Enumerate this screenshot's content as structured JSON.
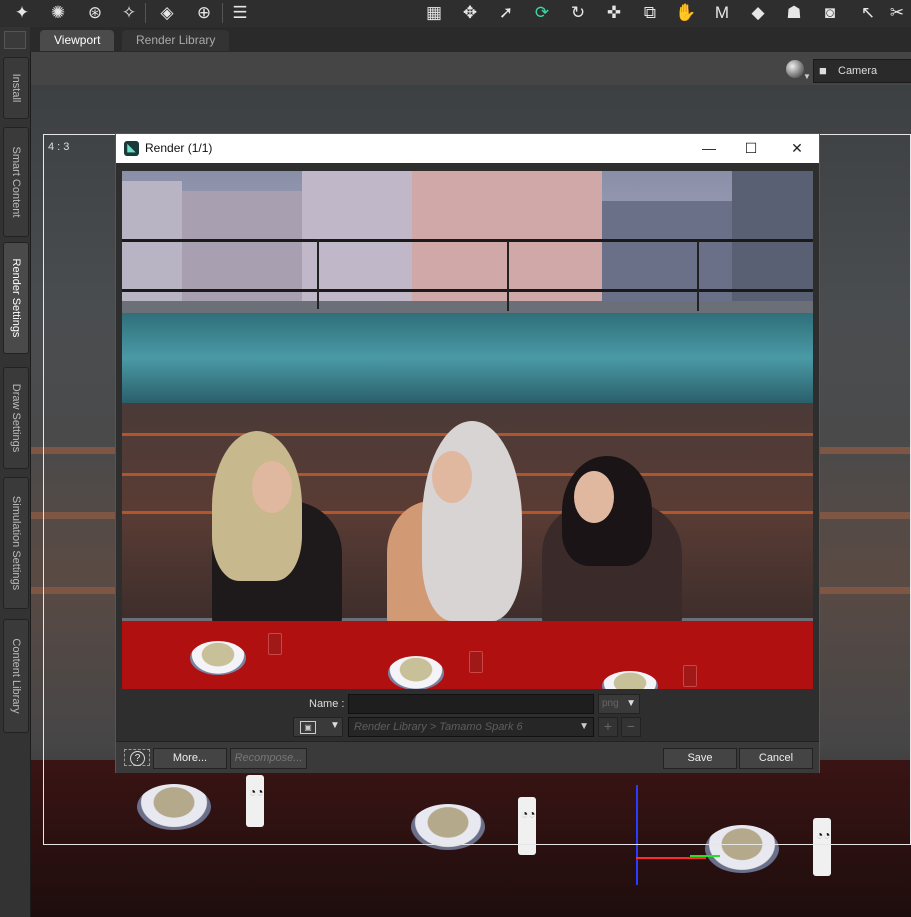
{
  "app": {
    "tabs": [
      {
        "label": "Viewport",
        "active": true
      },
      {
        "label": "Render Library",
        "active": false
      }
    ],
    "side_tabs": [
      "Install",
      "Smart Content",
      "Render Settings",
      "Draw Settings",
      "Simulation Settings",
      "Content Library"
    ],
    "camera_label": "Camera",
    "aspect_label": "4 : 3"
  },
  "dialog": {
    "title": "Render (1/1)",
    "name_label": "Name :",
    "name_value": "",
    "format_value": "png",
    "location_value": "Render Library > Tamamo Spark 6",
    "buttons": {
      "more": "More...",
      "recompose": "Recompose...",
      "save": "Save",
      "cancel": "Cancel"
    }
  },
  "icons": [
    "menu-icon",
    "pin-icon",
    "burst-icon",
    "dial-icon",
    "wand-icon",
    "spotlight-icon",
    "target-icon",
    "list-icon",
    "grid-icon",
    "move-view-icon",
    "pointer-icon",
    "rotate-view-icon",
    "rotate-icon",
    "translate-icon",
    "scale-icon",
    "joint-icon",
    "morph-icon",
    "paint-icon",
    "figure-icon",
    "render-camera-icon",
    "select-arrow-icon",
    "camera-icon",
    "help-icon"
  ]
}
